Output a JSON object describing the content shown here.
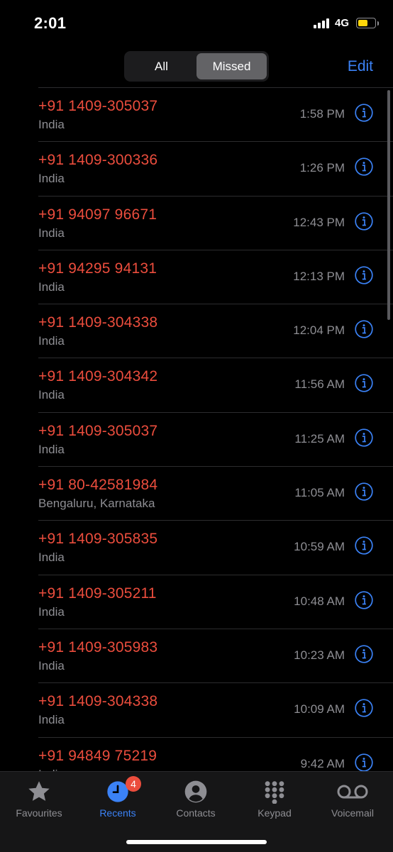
{
  "status_bar": {
    "time": "2:01",
    "network": "4G",
    "battery_level": 0.65,
    "battery_color": "#ffd60a"
  },
  "header": {
    "segments": [
      {
        "label": "All",
        "selected": false
      },
      {
        "label": "Missed",
        "selected": true
      }
    ],
    "edit_label": "Edit"
  },
  "calls": [
    {
      "number": "+91 1409-305037",
      "location": "India",
      "time": "1:58 PM"
    },
    {
      "number": "+91 1409-300336",
      "location": "India",
      "time": "1:26 PM"
    },
    {
      "number": "+91 94097 96671",
      "location": "India",
      "time": "12:43 PM"
    },
    {
      "number": "+91 94295 94131",
      "location": "India",
      "time": "12:13 PM"
    },
    {
      "number": "+91 1409-304338",
      "location": "India",
      "time": "12:04 PM"
    },
    {
      "number": "+91 1409-304342",
      "location": "India",
      "time": "11:56 AM"
    },
    {
      "number": "+91 1409-305037",
      "location": "India",
      "time": "11:25 AM"
    },
    {
      "number": "+91 80-42581984",
      "location": "Bengaluru, Karnataka",
      "time": "11:05 AM"
    },
    {
      "number": "+91 1409-305835",
      "location": "India",
      "time": "10:59 AM"
    },
    {
      "number": "+91 1409-305211",
      "location": "India",
      "time": "10:48 AM"
    },
    {
      "number": "+91 1409-305983",
      "location": "India",
      "time": "10:23 AM"
    },
    {
      "number": "+91 1409-304338",
      "location": "India",
      "time": "10:09 AM"
    },
    {
      "number": "+91 94849 75219",
      "location": "India",
      "time": "9:42 AM"
    }
  ],
  "tabbar": {
    "tabs": [
      {
        "label": "Favourites",
        "icon": "star-icon",
        "active": false
      },
      {
        "label": "Recents",
        "icon": "clock-icon",
        "active": true,
        "badge": "4"
      },
      {
        "label": "Contacts",
        "icon": "person-circle-icon",
        "active": false
      },
      {
        "label": "Keypad",
        "icon": "keypad-icon",
        "active": false
      },
      {
        "label": "Voicemail",
        "icon": "voicemail-icon",
        "active": false
      }
    ]
  },
  "colors": {
    "missed_red": "#eb4d3d",
    "accent_blue": "#3b82f6",
    "secondary_gray": "#8e8e93"
  }
}
